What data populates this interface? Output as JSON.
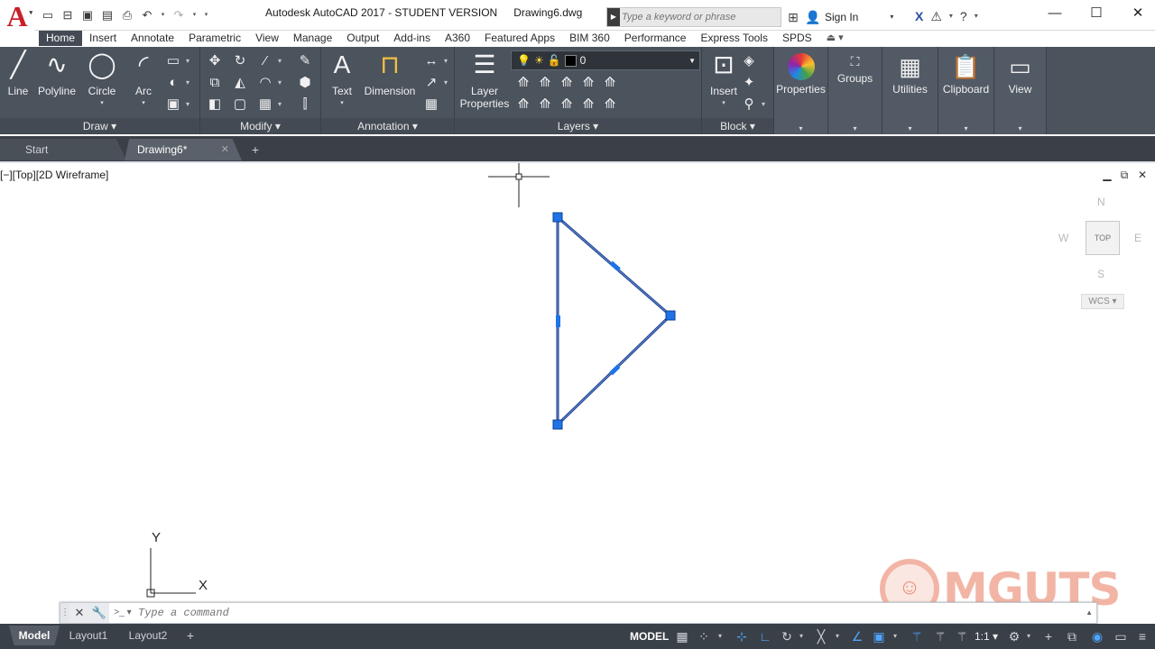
{
  "titlebar": {
    "app_logo": "A",
    "title": "Autodesk AutoCAD 2017 - STUDENT VERSION",
    "file": "Drawing6.dwg",
    "search_placeholder": "Type a keyword or phrase",
    "sign_in": "Sign In"
  },
  "ribbon_tabs": [
    "Home",
    "Insert",
    "Annotate",
    "Parametric",
    "View",
    "Manage",
    "Output",
    "Add-ins",
    "A360",
    "Featured Apps",
    "BIM 360",
    "Performance",
    "Express Tools",
    "SPDS"
  ],
  "active_tab": "Home",
  "panels": {
    "draw": {
      "title": "Draw",
      "tools": [
        "Line",
        "Polyline",
        "Circle",
        "Arc"
      ]
    },
    "modify": {
      "title": "Modify"
    },
    "annotation": {
      "title": "Annotation",
      "tools": [
        "Text",
        "Dimension"
      ]
    },
    "layers": {
      "title": "Layers",
      "layer_properties": "Layer\nProperties",
      "current_layer": "0"
    },
    "block": {
      "title": "Block",
      "insert": "Insert"
    },
    "properties": "Properties",
    "groups": "Groups",
    "utilities": "Utilities",
    "clipboard": "Clipboard",
    "view": "View"
  },
  "doc_tabs": {
    "start": "Start",
    "current": "Drawing6*"
  },
  "viewport": {
    "label": "[−][Top][2D Wireframe]"
  },
  "viewcube": {
    "n": "N",
    "s": "S",
    "e": "E",
    "w": "W",
    "face": "TOP",
    "wcs": "WCS"
  },
  "ucs": {
    "x": "X",
    "y": "Y"
  },
  "watermark": {
    "text": "MGUTS"
  },
  "command": {
    "placeholder": "Type a command"
  },
  "layouts": [
    "Model",
    "Layout1",
    "Layout2"
  ],
  "statusbar": {
    "space": "MODEL",
    "scale": "1:1"
  },
  "colors": {
    "ribbon": "#4b535d",
    "grip": "#1e74e6",
    "selection": "#1a3d8c",
    "accent_logo": "#c8202a"
  }
}
